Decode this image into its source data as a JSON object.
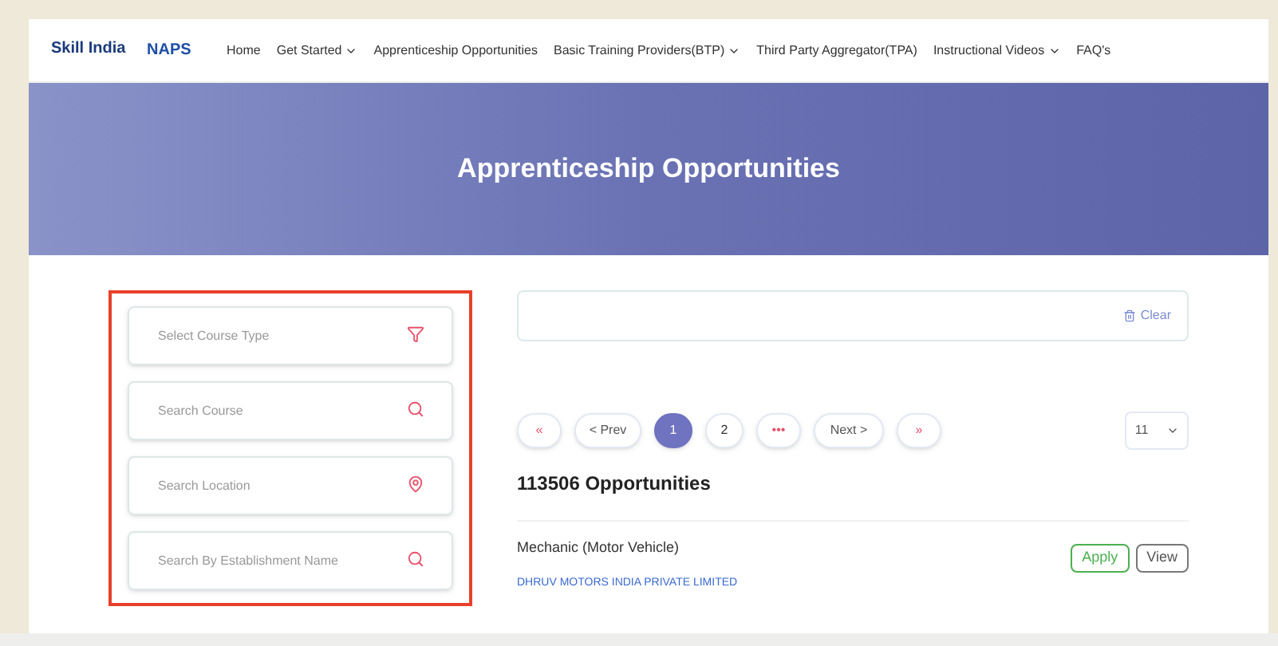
{
  "logos": [
    "Skill India",
    "NAPS"
  ],
  "nav": [
    {
      "label": "Home",
      "dropdown": false
    },
    {
      "label": "Get Started",
      "dropdown": true
    },
    {
      "label": "Apprenticeship Opportunities",
      "dropdown": false
    },
    {
      "label": "Basic Training Providers(BTP)",
      "dropdown": true
    },
    {
      "label": "Third Party Aggregator(TPA)",
      "dropdown": false
    },
    {
      "label": "Instructional Videos",
      "dropdown": true
    },
    {
      "label": "FAQ's",
      "dropdown": false
    }
  ],
  "hero": {
    "title": "Apprenticeship Opportunities"
  },
  "filters": [
    {
      "placeholder": "Select Course Type",
      "kind": "filter"
    },
    {
      "placeholder": "Search Course",
      "kind": "search"
    },
    {
      "placeholder": "Search Location",
      "kind": "location"
    },
    {
      "placeholder": "Search By Establishment Name",
      "kind": "search"
    }
  ],
  "clear": "Clear",
  "pagination": {
    "first": "«",
    "prev": "< Prev",
    "pages": [
      {
        "label": "1",
        "selected": true
      },
      {
        "label": "2",
        "selected": false
      }
    ],
    "ellipsis": "•••",
    "next": "Next >",
    "last": "»",
    "per_page": "11"
  },
  "count": "113506 Opportunities",
  "results": [
    {
      "title": "Mechanic (Motor Vehicle)",
      "company": "DHRUV MOTORS INDIA PRIVATE LIMITED",
      "apply": "Apply",
      "view": "View"
    }
  ]
}
